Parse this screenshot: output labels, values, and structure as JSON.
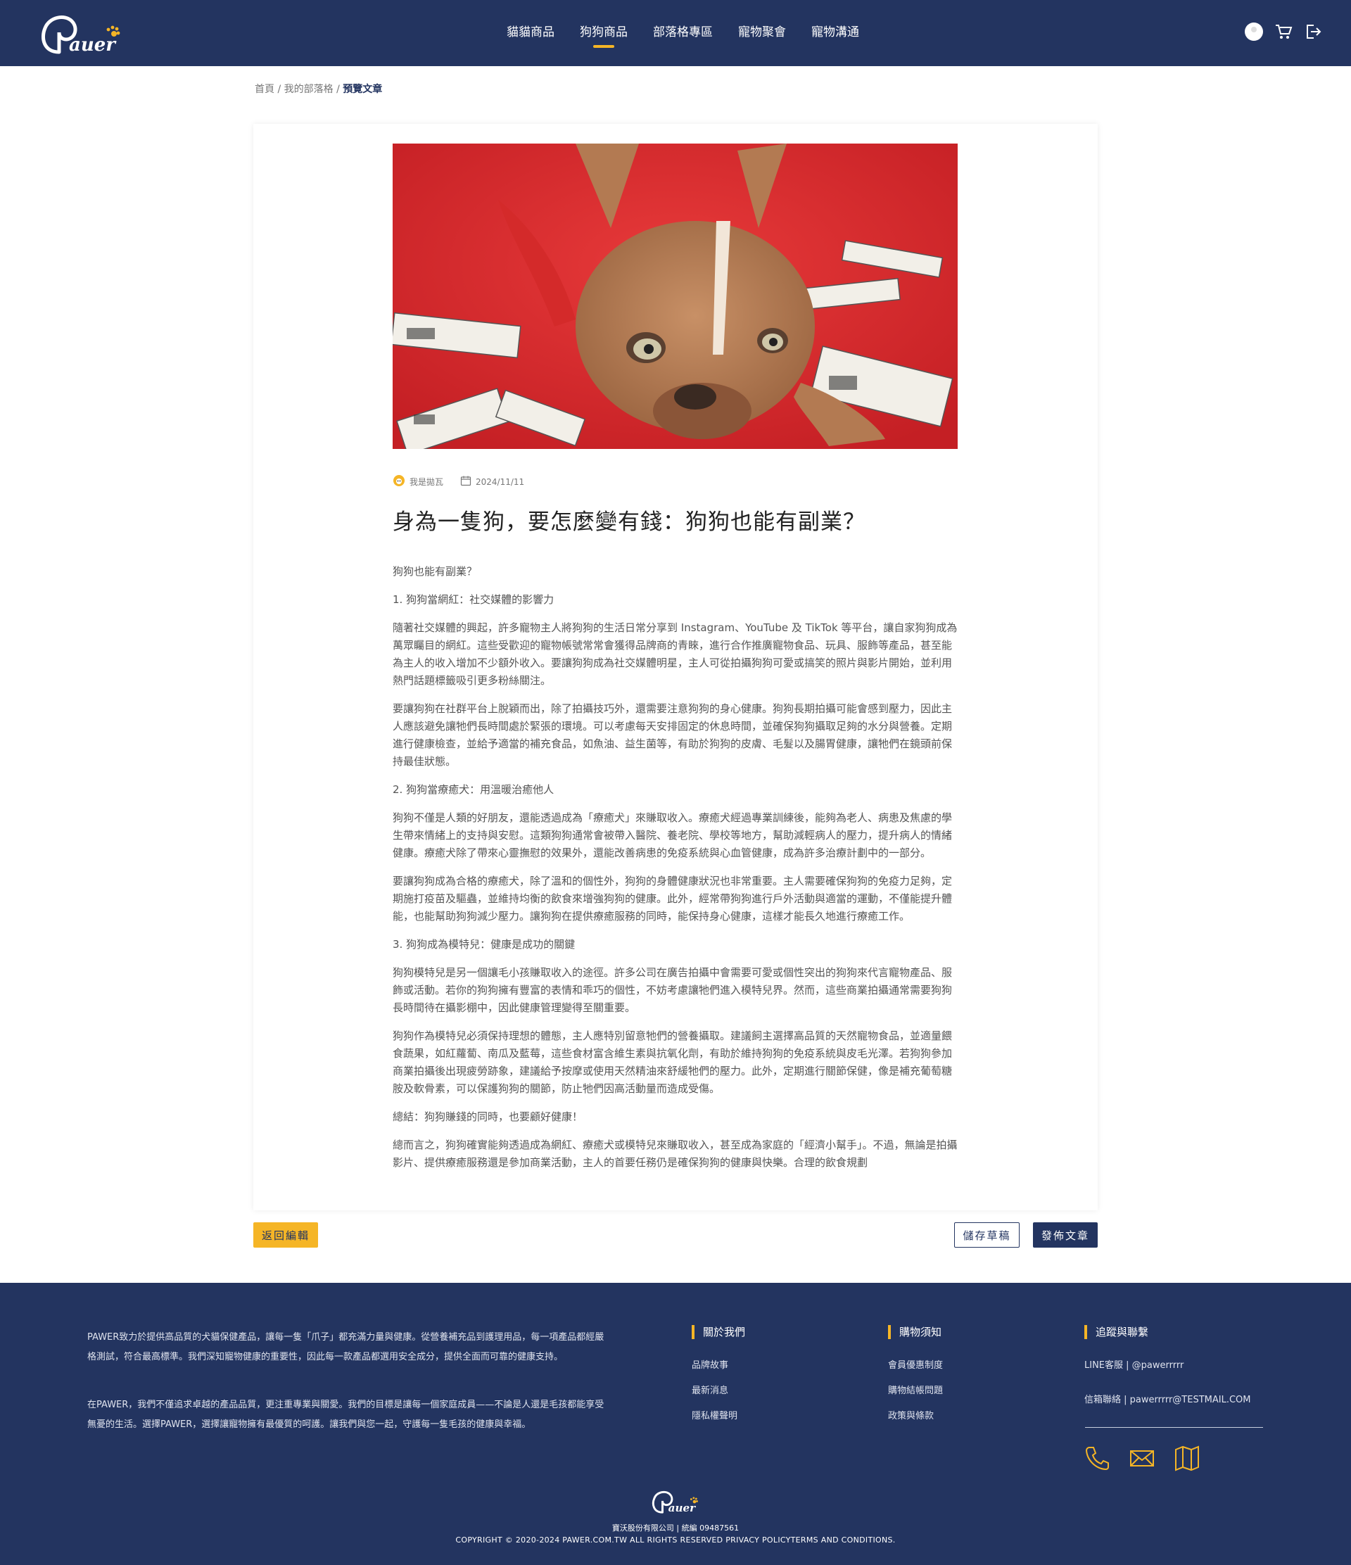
{
  "nav": {
    "brand": "Pawer",
    "items": [
      {
        "label": "貓貓商品",
        "active": false
      },
      {
        "label": "狗狗商品",
        "active": true
      },
      {
        "label": "部落格專區",
        "active": false
      },
      {
        "label": "寵物聚會",
        "active": false
      },
      {
        "label": "寵物溝通",
        "active": false
      }
    ],
    "icons": [
      "avatar-icon",
      "cart-icon",
      "logout-icon"
    ]
  },
  "breadcrumb": {
    "home": "首頁",
    "blog": "我的部落格",
    "current": "預覽文章",
    "sep": "/"
  },
  "article": {
    "author": "我是拋瓦",
    "date": "2024/11/11",
    "title": "身為一隻狗，要怎麼變有錢：狗狗也能有副業？",
    "paragraphs": [
      "狗狗也能有副業？",
      "1. 狗狗當網紅：社交媒體的影響力",
      "隨著社交媒體的興起，許多寵物主人將狗狗的生活日常分享到 Instagram、YouTube 及 TikTok 等平台，讓自家狗狗成為萬眾矚目的網紅。這些受歡迎的寵物帳號常常會獲得品牌商的青睞，進行合作推廣寵物食品、玩具、服飾等產品，甚至能為主人的收入增加不少額外收入。要讓狗狗成為社交媒體明星，主人可從拍攝狗狗可愛或搞笑的照片與影片開始，並利用熱門話題標籤吸引更多粉絲關注。",
      "要讓狗狗在社群平台上脫穎而出，除了拍攝技巧外，還需要注意狗狗的身心健康。狗狗長期拍攝可能會感到壓力，因此主人應該避免讓牠們長時間處於緊張的環境。可以考慮每天安排固定的休息時間，並確保狗狗攝取足夠的水分與營養。定期進行健康檢查，並給予適當的補充食品，如魚油、益生菌等，有助於狗狗的皮膚、毛髮以及腸胃健康，讓牠們在鏡頭前保持最佳狀態。",
      "2. 狗狗當療癒犬：用溫暖治癒他人",
      "狗狗不僅是人類的好朋友，還能透過成為「療癒犬」來賺取收入。療癒犬經過專業訓練後，能夠為老人、病患及焦慮的學生帶來情緒上的支持與安慰。這類狗狗通常會被帶入醫院、養老院、學校等地方，幫助減輕病人的壓力，提升病人的情緒健康。療癒犬除了帶來心靈撫慰的效果外，還能改善病患的免疫系統與心血管健康，成為許多治療計劃中的一部分。",
      "要讓狗狗成為合格的療癒犬，除了溫和的個性外，狗狗的身體健康狀況也非常重要。主人需要確保狗狗的免疫力足夠，定期施打疫苗及驅蟲，並維持均衡的飲食來增強狗狗的健康。此外，經常帶狗狗進行戶外活動與適當的運動，不僅能提升體能，也能幫助狗狗減少壓力。讓狗狗在提供療癒服務的同時，能保持身心健康，這樣才能長久地進行療癒工作。",
      "3. 狗狗成為模特兒：健康是成功的關鍵",
      "狗狗模特兒是另一個讓毛小孩賺取收入的途徑。許多公司在廣告拍攝中會需要可愛或個性突出的狗狗來代言寵物產品、服飾或活動。若你的狗狗擁有豐富的表情和乖巧的個性，不妨考慮讓牠們進入模特兒界。然而，這些商業拍攝通常需要狗狗長時間待在攝影棚中，因此健康管理變得至關重要。",
      "狗狗作為模特兒必須保持理想的體態，主人應特別留意牠們的營養攝取。建議飼主選擇高品質的天然寵物食品，並適量餵食蔬果，如紅蘿蔔、南瓜及藍莓，這些食材富含維生素與抗氧化劑，有助於維持狗狗的免疫系統與皮毛光澤。若狗狗參加商業拍攝後出現疲勞跡象，建議給予按摩或使用天然精油來舒緩牠們的壓力。此外，定期進行關節保健，像是補充葡萄糖胺及軟骨素，可以保護狗狗的關節，防止牠們因高活動量而造成受傷。",
      "總結：狗狗賺錢的同時，也要顧好健康！",
      "總而言之，狗狗確實能夠透過成為網紅、療癒犬或模特兒來賺取收入，甚至成為家庭的「經濟小幫手」。不過，無論是拍攝影片、提供療癒服務還是參加商業活動，主人的首要任務仍是確保狗狗的健康與快樂。合理的飲食規劃"
    ]
  },
  "actions": {
    "back": "返回編輯",
    "draft": "儲存草稿",
    "publish": "發佈文章"
  },
  "footer": {
    "about": [
      "PAWER致力於提供高品質的犬貓保健產品，讓每一隻「爪子」都充滿力量與健康。從營養補充品到護理用品，每一項產品都經嚴格測試，符合最高標準。我們深知寵物健康的重要性，因此每一款產品都選用安全成分，提供全面而可靠的健康支持。",
      "在PAWER，我們不僅追求卓越的產品品質，更注重專業與關愛。我們的目標是讓每一個家庭成員——不論是人還是毛孩都能享受無憂的生活。選擇PAWER，選擇讓寵物擁有最優質的呵護。讓我們與您一起，守護每一隻毛孩的健康與幸福。"
    ],
    "col1": {
      "heading": "關於我們",
      "links": [
        "品牌故事",
        "最新消息",
        "隱私權聲明"
      ]
    },
    "col2": {
      "heading": "購物須知",
      "links": [
        "會員優惠制度",
        "購物結帳問題",
        "政策與條款"
      ]
    },
    "col3": {
      "heading": "追蹤與聯繫",
      "line": "LINE客服 | @pawerrrrr",
      "mail": "信箱聯絡 | pawerrrrr@TESTMAIL.COM"
    },
    "icons": [
      "phone-icon",
      "mail-icon",
      "map-icon"
    ],
    "company": "寶沃股份有限公司 | 統編 09487561",
    "copyright": "COPYRIGHT © 2020-2024 PAWER.COM.TW ALL RIGHTS RESERVED PRIVACY POLICYTERMS AND CONDITIONS."
  },
  "colors": {
    "navy": "#233460",
    "accent": "#f5b526"
  }
}
